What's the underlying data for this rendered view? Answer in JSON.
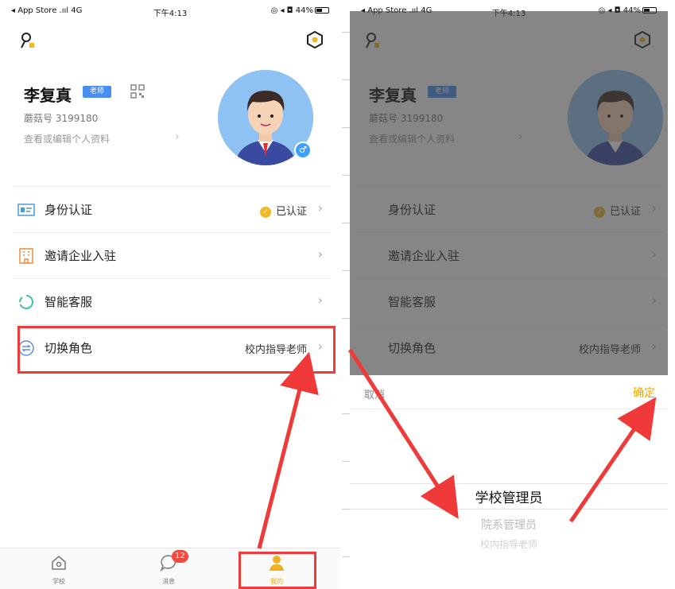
{
  "status_bar": {
    "carrier": "◂ App Store .ııl 4G",
    "time": "下午4:13",
    "right": "◎ ◂ ◘ 44%"
  },
  "profile": {
    "name": "李复真",
    "role_tag": "老师",
    "id_text": "蘑菇号 3199180",
    "edit_text": "查看或编辑个人资料"
  },
  "menu": [
    {
      "label": "身份认证",
      "value": "已认证",
      "verified": true,
      "icon": "id-card-icon"
    },
    {
      "label": "邀请企业入驻",
      "value": "",
      "icon": "building-icon"
    },
    {
      "label": "智能客服",
      "value": "",
      "icon": "service-icon"
    },
    {
      "label": "切换角色",
      "value": "校内指导老师",
      "icon": "switch-icon"
    }
  ],
  "tabs": [
    {
      "label": "学校",
      "icon": "home-icon"
    },
    {
      "label": "消息",
      "icon": "message-icon",
      "badge": "12"
    },
    {
      "label": "我的",
      "icon": "person-icon",
      "active": true
    }
  ],
  "picker": {
    "cancel": "取消",
    "confirm": "确定",
    "options": [
      "学校管理员",
      "院系管理员",
      "校内指导老师"
    ],
    "selected_index": 0
  },
  "colors": {
    "accent": "#f0a800",
    "tag_blue": "#4a8df0",
    "annotation_red": "#f03a3a",
    "badge_red": "#f04a3e"
  }
}
